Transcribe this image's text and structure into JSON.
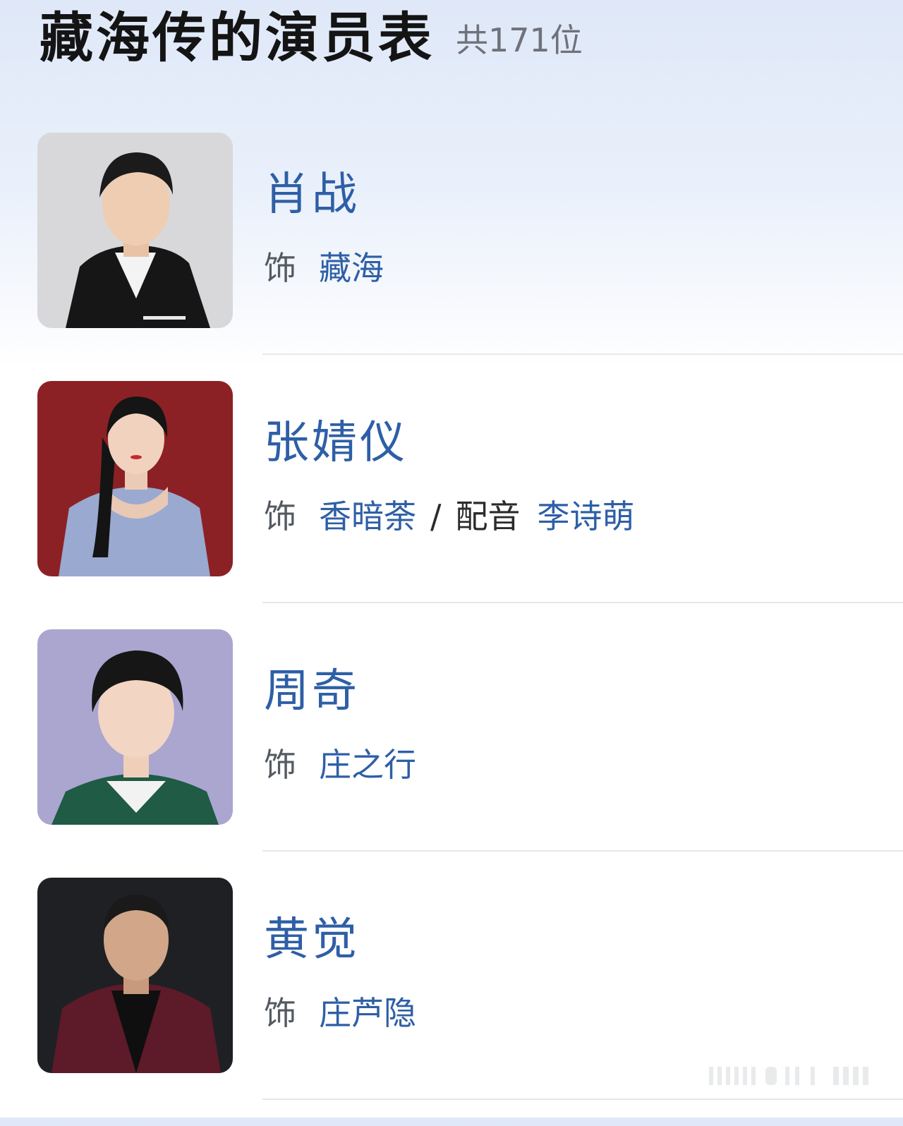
{
  "header": {
    "title": "藏海传的演员表",
    "count": "共171位"
  },
  "cast": [
    {
      "actor": "肖战",
      "role_prefix": "饰",
      "role": "藏海",
      "photo_bg": "#d9d9dc"
    },
    {
      "actor": "张婧仪",
      "role_prefix": "饰",
      "role": "香暗荼",
      "separator": "/",
      "dub_label": "配音",
      "dub_actor": "李诗萌",
      "photo_bg": "#8e2226"
    },
    {
      "actor": "周奇",
      "role_prefix": "饰",
      "role": "庄之行",
      "photo_bg": "#a9a5cf"
    },
    {
      "actor": "黄觉",
      "role_prefix": "饰",
      "role": "庄芦隐",
      "photo_bg": "#1f2125"
    }
  ],
  "colors": {
    "link_blue": "#2e5fa6",
    "prefix_gray": "#555a61",
    "title_black": "#141414"
  }
}
